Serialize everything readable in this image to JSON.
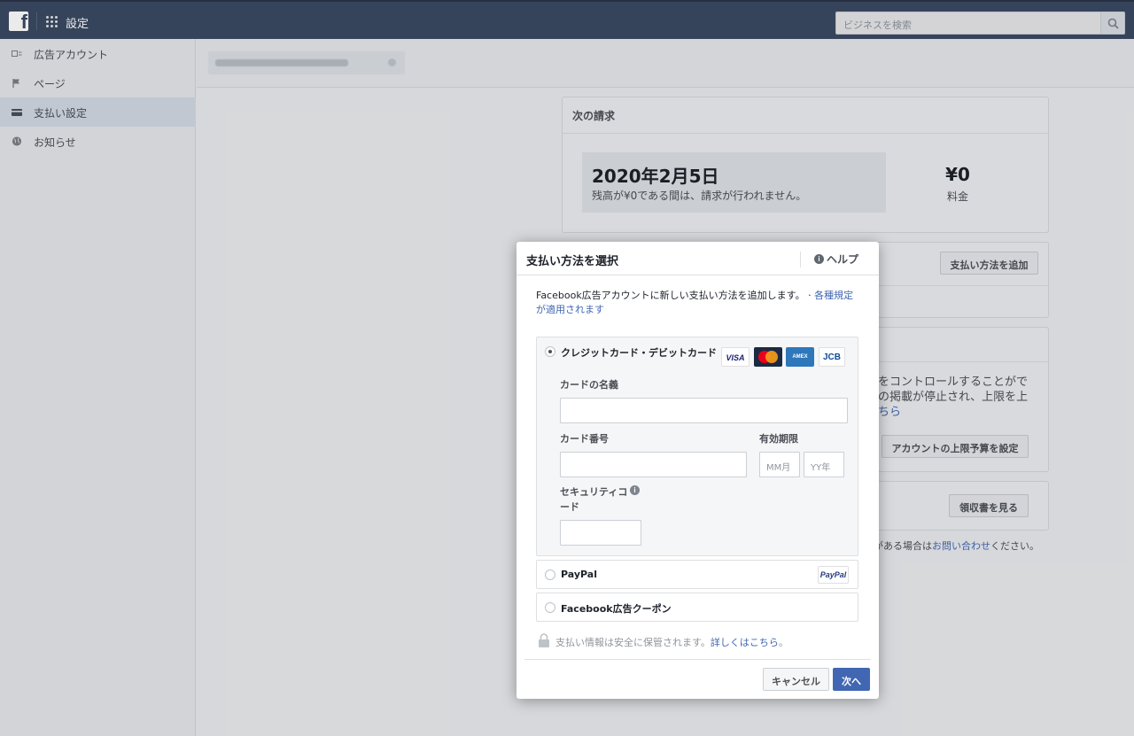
{
  "topbar": {
    "logo_glyph": "f",
    "title": "設定",
    "search_placeholder": "ビジネスを検索"
  },
  "sidebar": {
    "items": [
      {
        "label": "広告アカウント",
        "icon": "ad-account-icon"
      },
      {
        "label": "ページ",
        "icon": "flag-icon"
      },
      {
        "label": "支払い設定",
        "icon": "credit-card-icon",
        "active": true
      },
      {
        "label": "お知らせ",
        "icon": "globe-icon"
      }
    ]
  },
  "background": {
    "next_billing_title": "次の請求",
    "billing_date": "2020年2月5日",
    "billing_note": "残高が¥0である間は、請求が行われません。",
    "amount": "¥0",
    "amount_label": "料金",
    "add_payment_button": "支払い方法を追加",
    "limit_text_1": "をコントロールすることがで",
    "limit_text_2": "の掲載が停止され、上限を上",
    "limit_text_3": "ちら",
    "limit_button": "アカウントの上限予算を設定",
    "receipt_button": "領収書を見る",
    "contact_prefix": "がある場合は",
    "contact_link": "お問い合わせ",
    "contact_suffix": "ください。"
  },
  "dialog": {
    "title": "支払い方法を選択",
    "help": "ヘルプ",
    "intro": "Facebook広告アカウントに新しい支払い方法を追加します。 · ",
    "terms_link": "各種規定が適用されます",
    "credit_option": "クレジットカード・デビットカード",
    "card_logos": [
      "VISA",
      "MC",
      "AMEX",
      "JCB"
    ],
    "name_label": "カードの名義",
    "number_label": "カード番号",
    "expiry_label": "有効期限",
    "month_placeholder": "MM月",
    "year_placeholder": "YY年",
    "security_label_1": "セキュリティコ",
    "security_label_2": "ード",
    "paypal_option": "PayPal",
    "paypal_logo": "PayPal",
    "coupon_option": "Facebook広告クーポン",
    "secure_text": "支払い情報は安全に保管されます。",
    "secure_link": "詳しくはこちら",
    "secure_end": "。",
    "cancel": "キャンセル",
    "next": "次へ"
  },
  "colors": {
    "topbar": "#3b4a63",
    "link": "#4267b2",
    "primary_button": "#4267b2"
  }
}
